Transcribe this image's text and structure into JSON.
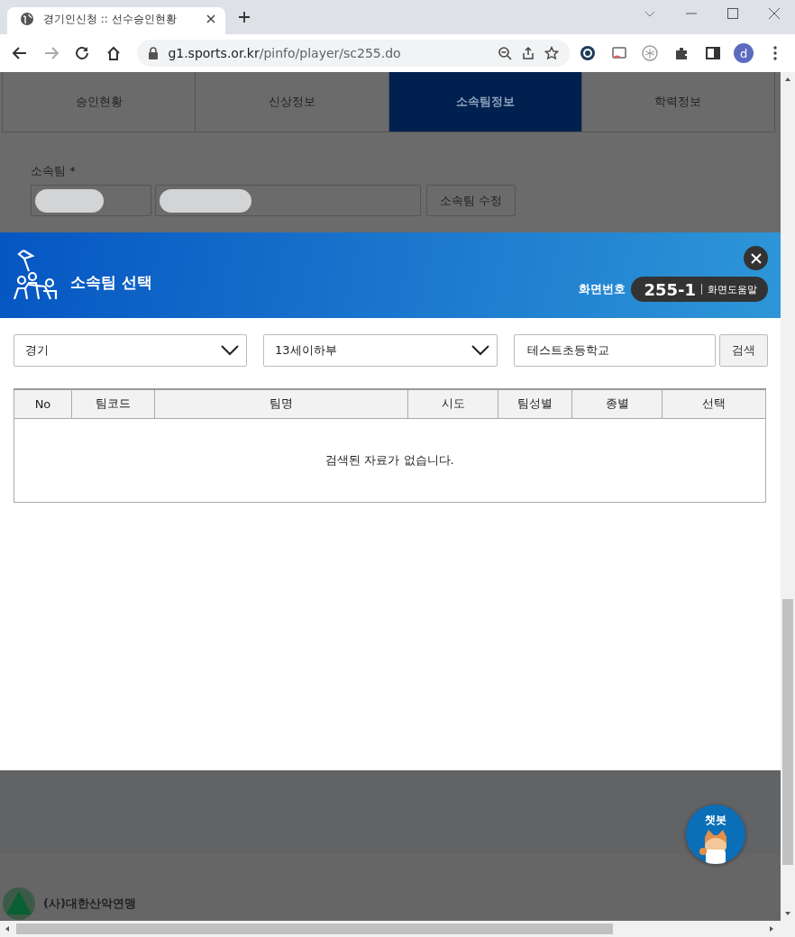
{
  "browser": {
    "tab_title": "경기인신청 :: 선수승인현황",
    "url_host": "g1.sports.or.kr",
    "url_path": "/pinfo/player/sc255.do",
    "profile": "d"
  },
  "page_tabs": [
    {
      "label": "승인현황",
      "selected": false
    },
    {
      "label": "신상정보",
      "selected": false
    },
    {
      "label": "소속팀정보",
      "selected": true
    },
    {
      "label": "학력정보",
      "selected": false
    }
  ],
  "team_form": {
    "label": "소속팀 *",
    "button": "소속팀 수정"
  },
  "modal": {
    "title": "소속팀 선택",
    "screen_number_label": "화면번호",
    "screen_number": "255-1",
    "help": "화면도움말",
    "filters": {
      "region": "경기",
      "division": "13세이하부",
      "search_value": "테스트초등학교",
      "search_button": "검색"
    },
    "table": {
      "columns": [
        "No",
        "팀코드",
        "팀명",
        "시도",
        "팀성별",
        "종별",
        "선택"
      ],
      "empty_message": "검색된 자료가 없습니다."
    }
  },
  "chatbot": {
    "label": "챗봇"
  },
  "footer": {
    "org": "(사)대한산악연맹"
  }
}
